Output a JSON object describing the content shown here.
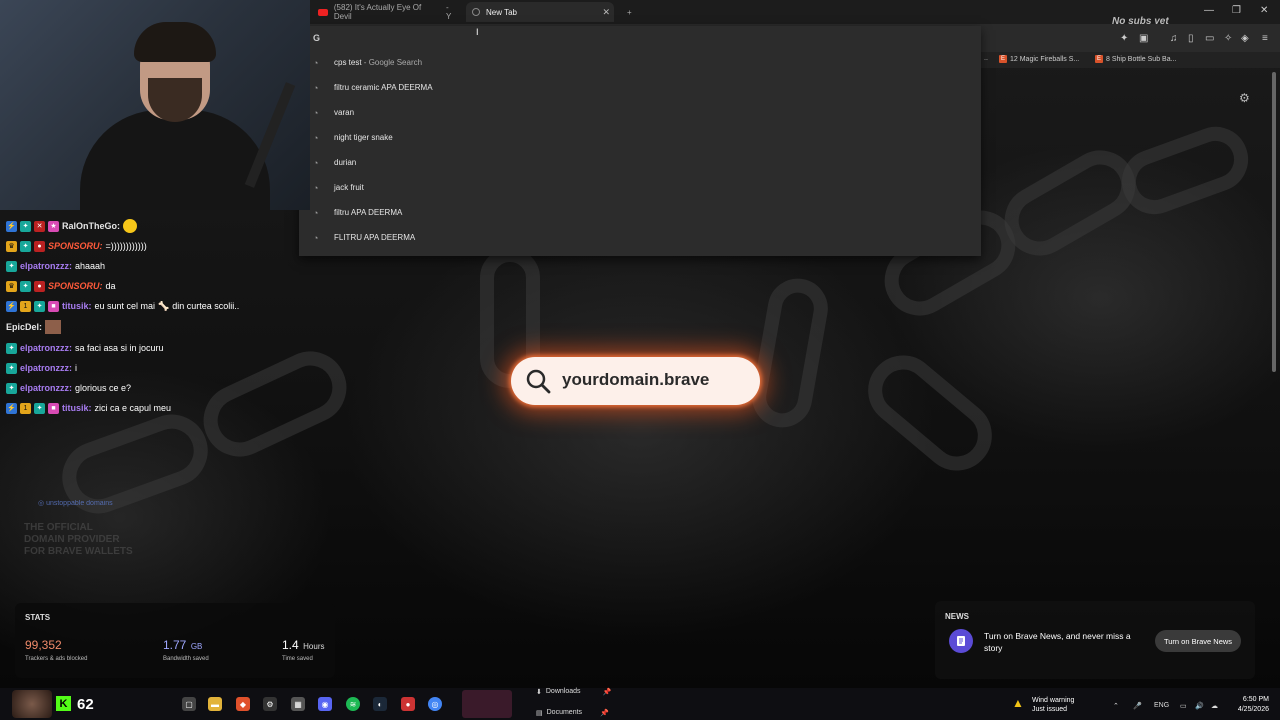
{
  "tabs": [
    {
      "label": "(582) It's Actually Eye Of Devil",
      "icon": "youtube-icon",
      "suffix": "- Y"
    },
    {
      "label": "New Tab",
      "icon": "brave-icon",
      "active": true
    }
  ],
  "overlay": {
    "nosubs": "No subs yet"
  },
  "bookmarks": [
    {
      "label": "12 Magic Fireballs S..."
    },
    {
      "label": "8 Ship Bottle Sub Ba..."
    }
  ],
  "omnibox": {
    "provider": "G",
    "suggestions": [
      {
        "text": "cps test",
        "suffix": " - Google Search"
      },
      {
        "text": "filtru ceramic APA DEERMA",
        "suffix": ""
      },
      {
        "text": "varan",
        "suffix": ""
      },
      {
        "text": "night tiger snake",
        "suffix": ""
      },
      {
        "text": "durian",
        "suffix": ""
      },
      {
        "text": "jack fruit",
        "suffix": ""
      },
      {
        "text": "filtru APA DEERMA",
        "suffix": ""
      },
      {
        "text": "FLITRU APA DEERMA",
        "suffix": ""
      }
    ]
  },
  "chat": [
    {
      "user": "RalOnTheGo:",
      "text": "",
      "color": "white",
      "badges": [
        "blue",
        "teal",
        "pink"
      ],
      "emote": "smile"
    },
    {
      "user": "SPONSORU:",
      "text": "=))))))))))))",
      "color": "red",
      "badges": [
        "gold",
        "teal",
        "red"
      ]
    },
    {
      "user": "elpatronzzz:",
      "text": "ahaaah",
      "color": "purple",
      "badges": [
        "teal"
      ]
    },
    {
      "user": "SPONSORU:",
      "text": "da",
      "color": "red",
      "badges": [
        "gold",
        "teal",
        "red"
      ]
    },
    {
      "user": "titusik:",
      "text": "eu sunt cel mai",
      "text2": "din curtea scolii..",
      "color": "purple",
      "badges": [
        "blue",
        "gold",
        "teal",
        "pink"
      ]
    },
    {
      "user": "EpicDel:",
      "text": "",
      "color": "white",
      "badges": [],
      "emote": "square"
    },
    {
      "user": "elpatronzzz:",
      "text": "sa faci asa si in jocuru",
      "color": "purple",
      "badges": [
        "teal"
      ]
    },
    {
      "user": "elpatronzzz:",
      "text": "i",
      "color": "purple",
      "badges": [
        "teal"
      ]
    },
    {
      "user": "elpatronzzz:",
      "text": "glorious ce e?",
      "color": "purple",
      "badges": [
        "teal"
      ]
    },
    {
      "user": "titusik:",
      "text": "zici ca e capul meu",
      "color": "purple",
      "badges": [
        "blue",
        "gold",
        "teal",
        "pink"
      ]
    }
  ],
  "sponsor": {
    "logo": "unstoppable domains",
    "ghost": "THE OFFICIAL DOMAIN PROVIDER FOR BRAVE WALLETS"
  },
  "search": {
    "domain": "yourdomain.brave"
  },
  "stats": {
    "title": "STATS",
    "items": [
      {
        "value": "99,352",
        "unit": "",
        "label": "Trackers & ads blocked",
        "color": "#f08a6a"
      },
      {
        "value": "1.77",
        "unit": "GB",
        "label": "Bandwidth saved",
        "color": "#9fa7ff"
      },
      {
        "value": "1.4",
        "unit": "Hours",
        "label": "Time saved",
        "color": "#ffffff"
      }
    ]
  },
  "news": {
    "title": "NEWS",
    "text": "Turn on Brave News, and never miss a story",
    "button": "Turn on Brave News"
  },
  "taskbar": {
    "viewers": "62",
    "popup": [
      {
        "label": "Downloads"
      },
      {
        "label": "Documents"
      }
    ],
    "weather_title": "Wind warning",
    "weather_sub": "Just issued",
    "lang": "ENG",
    "time": "6:50 PM",
    "date": "4/25/2026"
  }
}
